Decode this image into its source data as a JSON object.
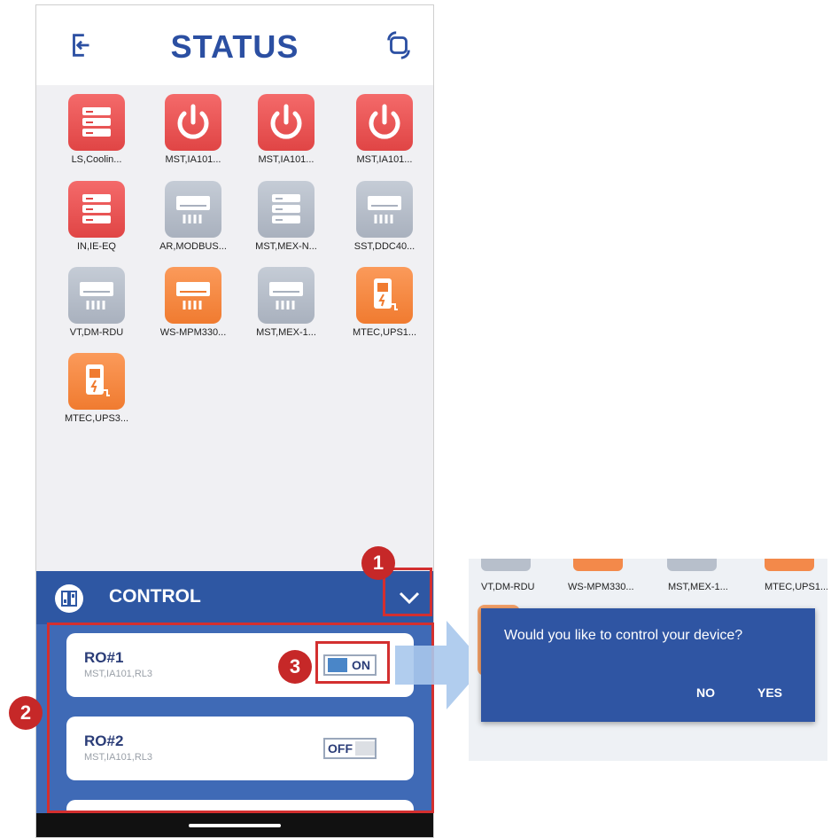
{
  "header": {
    "title": "STATUS",
    "left_icon": "logout-icon",
    "right_icon": "switch-view-icon"
  },
  "devices": [
    {
      "label": "LS,Coolin...",
      "color": "red",
      "icon": "server-rack-icon"
    },
    {
      "label": "MST,IA101...",
      "color": "red",
      "icon": "power-icon"
    },
    {
      "label": "MST,IA101...",
      "color": "red",
      "icon": "power-icon"
    },
    {
      "label": "MST,IA101...",
      "color": "red",
      "icon": "power-icon"
    },
    {
      "label": "IN,IE-EQ",
      "color": "red",
      "icon": "server-rack-icon"
    },
    {
      "label": "AR,MODBUS...",
      "color": "gray",
      "icon": "air-conditioner-icon"
    },
    {
      "label": "MST,MEX-N...",
      "color": "gray",
      "icon": "server-rack-icon"
    },
    {
      "label": "SST,DDC40...",
      "color": "gray",
      "icon": "air-conditioner-icon"
    },
    {
      "label": "VT,DM-RDU",
      "color": "gray",
      "icon": "air-conditioner-icon"
    },
    {
      "label": "WS-MPM330...",
      "color": "orange",
      "icon": "air-conditioner-icon"
    },
    {
      "label": "MST,MEX-1...",
      "color": "gray",
      "icon": "air-conditioner-icon"
    },
    {
      "label": "MTEC,UPS1...",
      "color": "orange",
      "icon": "ups-battery-icon"
    },
    {
      "label": "MTEC,UPS3...",
      "color": "orange",
      "icon": "ups-battery-icon"
    }
  ],
  "control": {
    "label": "CONTROL",
    "icon": "control-panel-icon",
    "items": [
      {
        "name": "RO#1",
        "sub": "MST,IA101,RL3",
        "state": "ON"
      },
      {
        "name": "RO#2",
        "sub": "MST,IA101,RL3",
        "state": "OFF"
      }
    ]
  },
  "annotations": {
    "one": "1",
    "two": "2",
    "three": "3"
  },
  "popup": {
    "bg_labels": [
      "VT,DM-RDU",
      "WS-MPM330...",
      "MST,MEX-1...",
      "MTEC,UPS1..."
    ],
    "question": "Would you like to control your device?",
    "no": "NO",
    "yes": "YES"
  },
  "colors": {
    "accent": "#2e57a3",
    "title": "#2b4fa2",
    "annotation": "#c62828"
  }
}
